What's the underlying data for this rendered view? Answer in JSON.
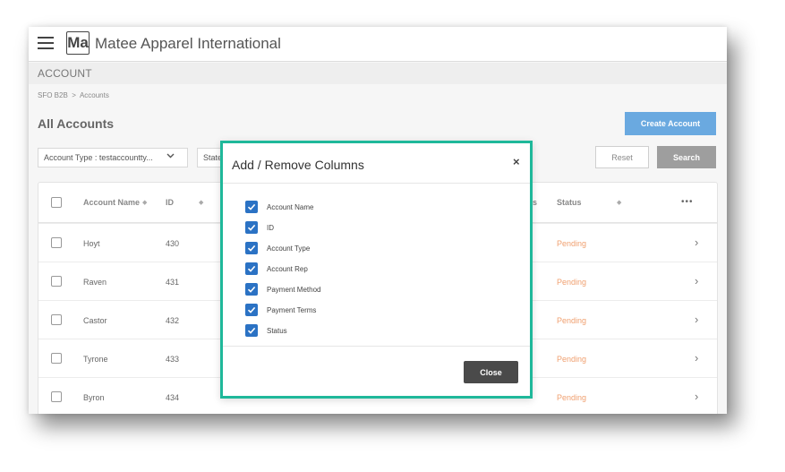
{
  "app": {
    "logo_text": "Ma",
    "title": "Matee Apparel International"
  },
  "section": {
    "label": "ACCOUNT"
  },
  "breadcrumb": {
    "root": "SFO B2B",
    "separator": ">",
    "current": "Accounts"
  },
  "page": {
    "title": "All Accounts"
  },
  "toolbar": {
    "create_label": "Create Account",
    "filter_account_type": "Account Type : testaccountty...",
    "filter_status_partial": "State",
    "reset_label": "Reset",
    "search_label": "Search"
  },
  "table": {
    "headers": {
      "account_name": "Account Name",
      "id": "ID",
      "status": "Status",
      "partial": "s",
      "more": "•••"
    },
    "rows": [
      {
        "name": "Hoyt",
        "id": "430",
        "status": "Pending"
      },
      {
        "name": "Raven",
        "id": "431",
        "status": "Pending"
      },
      {
        "name": "Castor",
        "id": "432",
        "status": "Pending"
      },
      {
        "name": "Tyrone",
        "id": "433",
        "status": "Pending"
      },
      {
        "name": "Byron",
        "id": "434",
        "status": "Pending"
      }
    ]
  },
  "modal": {
    "title": "Add / Remove Columns",
    "close_x": "×",
    "options": [
      {
        "label": "Account Name",
        "checked": true
      },
      {
        "label": "ID",
        "checked": true
      },
      {
        "label": "Account Type",
        "checked": true
      },
      {
        "label": "Account Rep",
        "checked": true
      },
      {
        "label": "Payment Method",
        "checked": true
      },
      {
        "label": "Payment Terms",
        "checked": true
      },
      {
        "label": "Status",
        "checked": true
      }
    ],
    "close_label": "Close"
  },
  "colors": {
    "accent": "#1fb89a",
    "checkbox": "#2b72c4",
    "pending": "#f0a070",
    "create_button": "#6aa9e0"
  }
}
